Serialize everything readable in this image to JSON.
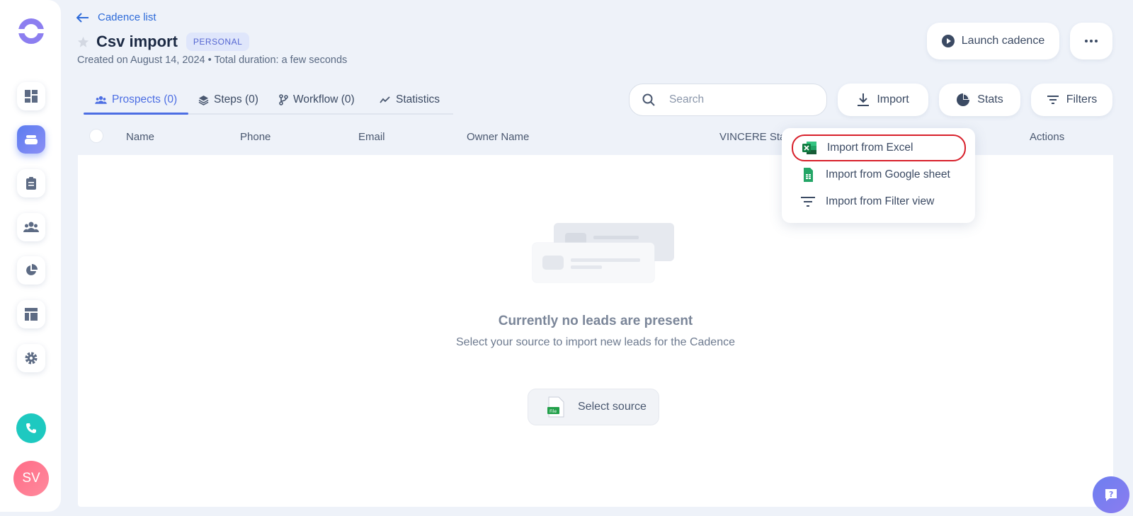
{
  "header": {
    "back_label": "Cadence list",
    "title": "Csv import",
    "badge": "PERSONAL",
    "subtitle": "Created on August 14, 2024 • Total duration: a few seconds",
    "launch_label": "Launch cadence"
  },
  "tabs": [
    {
      "label": "Prospects (0)",
      "icon": "users-icon",
      "active": true
    },
    {
      "label": "Steps (0)",
      "icon": "layers-icon"
    },
    {
      "label": "Workflow (0)",
      "icon": "branch-icon"
    },
    {
      "label": "Statistics",
      "icon": "trend-icon"
    }
  ],
  "toolbar": {
    "search_placeholder": "Search",
    "import_label": "Import",
    "stats_label": "Stats",
    "filters_label": "Filters"
  },
  "table": {
    "columns": [
      "Name",
      "Phone",
      "Email",
      "Owner Name",
      "VINCERE Stat",
      "Actions"
    ]
  },
  "empty_state": {
    "title": "Currently no leads are present",
    "subtitle": "Select your source to import new leads for the Cadence",
    "button_label": "Select source"
  },
  "import_menu": {
    "items": [
      {
        "label": "Import from Excel",
        "icon": "excel-icon",
        "highlighted": true
      },
      {
        "label": "Import from Google sheet",
        "icon": "google-sheet-icon"
      },
      {
        "label": "Import from Filter view",
        "icon": "filter-icon"
      }
    ]
  },
  "user": {
    "initials": "SV"
  },
  "colors": {
    "accent": "#4c6ee3",
    "highlight": "#d81f2a",
    "phone": "#1ec9c0",
    "avatar": "#ff6c87"
  }
}
